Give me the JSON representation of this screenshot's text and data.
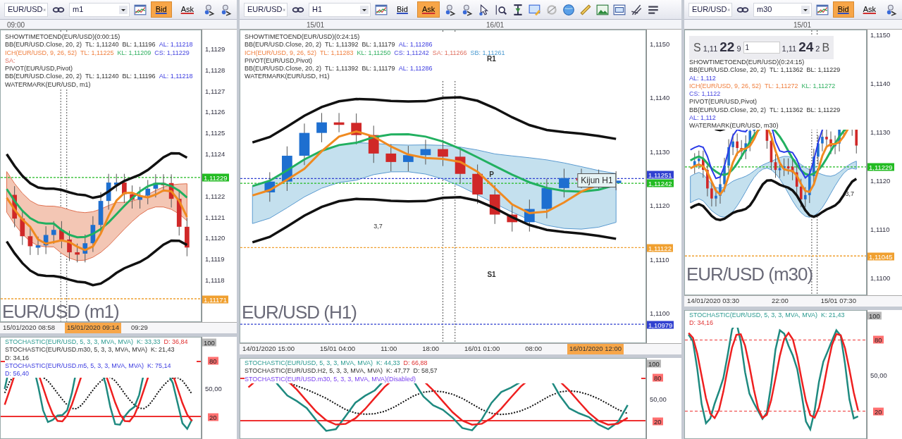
{
  "panels": [
    {
      "toolbar": {
        "symbol": "EUR/USD",
        "timeframe": "m1",
        "bid": {
          "label": "Bid",
          "selected": true
        },
        "ask": {
          "label": "Ask",
          "selected": false
        }
      },
      "top_times": [
        "09:00"
      ],
      "legend": [
        [
          {
            "text": "SHOWTIMETOEND(EUR/USD)(0:00:15)",
            "kind": "plain"
          }
        ],
        [
          {
            "text": "BB(EUR/USD.Close, 20, 2)",
            "kind": "plain"
          },
          {
            "text": "TL: 1,11240",
            "kind": "plain"
          },
          {
            "text": "BL: 1,11196",
            "kind": "plain"
          },
          {
            "text": "AL: 1,11218",
            "kind": "average"
          }
        ],
        [
          {
            "text": "ICH(EUR/USD, 9, 26, 52)",
            "kind": "ichimoku"
          },
          {
            "text": "TL: 1,11225",
            "kind": "ichimoku"
          },
          {
            "text": "KL: 1,11209",
            "kind": "kijun"
          },
          {
            "text": "CS: 1,11229",
            "kind": "chikou"
          },
          {
            "text": "SA:",
            "kind": "span_a"
          }
        ],
        [
          {
            "text": "PIVOT(EUR/USD,Pivot)",
            "kind": "plain"
          }
        ],
        [
          {
            "text": "BB(EUR/USD.Close, 20, 2)",
            "kind": "plain"
          },
          {
            "text": "TL: 1,11240",
            "kind": "plain"
          },
          {
            "text": "BL: 1,11196",
            "kind": "plain"
          },
          {
            "text": "AL: 1,11218",
            "kind": "average"
          }
        ],
        [
          {
            "text": "WATERMARK(EUR/USD, m1)",
            "kind": "plain"
          }
        ]
      ],
      "watermark": "EUR/USD (m1)",
      "price_ticks": [
        "1,1129",
        "1,1128",
        "1,1127",
        "1,1126",
        "1,1125",
        "1,1124",
        "1,1122",
        "1,1121",
        "1,1120",
        "1,1119",
        "1,1118"
      ],
      "price_tags": [
        {
          "text": "1,11229",
          "color": "#22bb22"
        },
        {
          "text": "1,11171",
          "color": "#f0a030"
        }
      ],
      "time_ticks": [
        {
          "text": "15/01/2020 08:58",
          "selected": false
        },
        {
          "text": "15/01/2020 09:14",
          "selected": true
        },
        {
          "text": "09:29",
          "selected": false
        }
      ],
      "stochastic": {
        "legend": [
          [
            {
              "text": "STOCHASTIC(EUR/USD, 5, 3, 3, MVA, MVA)",
              "kind": "stoch_k"
            },
            {
              "text": "K: 33,33",
              "kind": "stoch_k"
            },
            {
              "text": "D: 36,84",
              "kind": "stoch_d"
            }
          ],
          [
            {
              "text": "STOCHASTIC(EUR/USD.m30, 5, 3, 3, MVA, MVA)",
              "kind": "plain"
            },
            {
              "text": "K: 21,43",
              "kind": "plain"
            },
            {
              "text": "D: 34,16",
              "kind": "plain"
            }
          ],
          [
            {
              "text": "STOCHASTIC(EUR/USD.m5, 5, 3, 3, MVA, MVA)",
              "kind": "average"
            },
            {
              "text": "K: 75,14",
              "kind": "average"
            },
            {
              "text": "D: 56,40",
              "kind": "average"
            }
          ]
        ],
        "ticks": [
          {
            "text": "100",
            "kind": "top"
          },
          {
            "text": "80",
            "kind": "level"
          },
          {
            "text": "50,00",
            "kind": "plain"
          },
          {
            "text": "20",
            "kind": "level"
          }
        ]
      }
    },
    {
      "toolbar": {
        "symbol": "EUR/USD",
        "timeframe": "H1",
        "bid": {
          "label": "Bid",
          "selected": false
        },
        "ask": {
          "label": "Ask",
          "selected": true
        }
      },
      "top_times": [
        "15/01",
        "16/01"
      ],
      "legend": [
        [
          {
            "text": "SHOWTIMETOEND(EUR/USD)(0:24:15)",
            "kind": "plain"
          }
        ],
        [
          {
            "text": "BB(EUR/USD.Close, 20, 2)",
            "kind": "plain"
          },
          {
            "text": "TL: 1,11392",
            "kind": "plain"
          },
          {
            "text": "BL: 1,11179",
            "kind": "plain"
          },
          {
            "text": "AL: 1,11286",
            "kind": "average"
          }
        ],
        [
          {
            "text": "ICH(EUR/USD, 9, 26, 52)",
            "kind": "ichimoku"
          },
          {
            "text": "TL: 1,11283",
            "kind": "ichimoku"
          },
          {
            "text": "KL: 1,11250",
            "kind": "kijun"
          },
          {
            "text": "CS: 1,11242",
            "kind": "chikou"
          },
          {
            "text": "SA: 1,11266",
            "kind": "span_a"
          },
          {
            "text": "SB: 1,11261",
            "kind": "span_b"
          }
        ],
        [
          {
            "text": "PIVOT(EUR/USD,Pivot)",
            "kind": "plain"
          }
        ],
        [
          {
            "text": "BB(EUR/USD.Close, 20, 2)",
            "kind": "plain"
          },
          {
            "text": "TL: 1,11392",
            "kind": "plain"
          },
          {
            "text": "BL: 1,11179",
            "kind": "plain"
          },
          {
            "text": "AL: 1,11286",
            "kind": "average"
          }
        ],
        [
          {
            "text": "WATERMARK(EUR/USD, H1)",
            "kind": "plain"
          }
        ]
      ],
      "watermark": "EUR/USD (H1)",
      "labels": [
        {
          "text": "R1",
          "kind": "pivot"
        },
        {
          "text": "P",
          "kind": "pivot"
        },
        {
          "text": "S1",
          "kind": "pivot"
        },
        {
          "text": "Kijun H1",
          "kind": "box"
        },
        {
          "text": "3,7",
          "kind": "note"
        }
      ],
      "price_ticks": [
        "1,1150",
        "1,1140",
        "1,1130",
        "1,1120",
        "1,1110",
        "1,1100"
      ],
      "price_tags": [
        {
          "text": "1,11251",
          "color": "#3040d0"
        },
        {
          "text": "1,11242",
          "color": "#22bb22"
        },
        {
          "text": "1,11122",
          "color": "#f0a030"
        },
        {
          "text": "1,10979",
          "color": "#3040d0"
        }
      ],
      "time_ticks": [
        {
          "text": "14/01/2020 15:00",
          "selected": false
        },
        {
          "text": "15/01 04:00",
          "selected": false
        },
        {
          "text": "11:00",
          "selected": false
        },
        {
          "text": "18:00",
          "selected": false
        },
        {
          "text": "16/01 01:00",
          "selected": false
        },
        {
          "text": "08:00",
          "selected": false
        },
        {
          "text": "16/01/2020 12:00",
          "selected": true
        }
      ],
      "stochastic": {
        "legend": [
          [
            {
              "text": "STOCHASTIC(EUR/USD, 5, 3, 3, MVA, MVA)",
              "kind": "stoch_k"
            },
            {
              "text": "K: 44,33",
              "kind": "stoch_k"
            },
            {
              "text": "D: 66,88",
              "kind": "stoch_d"
            }
          ],
          [
            {
              "text": "STOCHASTIC(EUR/USD.H2, 5, 3, 3, MVA, MVA)",
              "kind": "plain"
            },
            {
              "text": "K: 47,77",
              "kind": "plain"
            },
            {
              "text": "D: 58,57",
              "kind": "plain"
            }
          ],
          [
            {
              "text": "STOCHASTIC(EUR/USD.m30, 5, 3, 3, MVA, MVA)(Disabled)",
              "kind": "disabled"
            }
          ]
        ],
        "ticks": [
          {
            "text": "100",
            "kind": "top"
          },
          {
            "text": "80",
            "kind": "level"
          },
          {
            "text": "50,00",
            "kind": "plain"
          },
          {
            "text": "20",
            "kind": "level"
          }
        ]
      }
    },
    {
      "toolbar": {
        "symbol": "EUR/USD",
        "timeframe": "m30",
        "bid": {
          "label": "Bid",
          "selected": true
        },
        "ask": {
          "label": "Ask",
          "selected": false
        }
      },
      "top_times": [
        "15/01"
      ],
      "quote": {
        "sell_label": "S",
        "sell_prefix": "1,11",
        "sell_big": "22",
        "sell_pip": "9",
        "amount": "1",
        "buy_prefix": "1,11",
        "buy_big": "24",
        "buy_pip": "2",
        "buy_label": "B"
      },
      "legend": [
        [
          {
            "text": "SHOWTIMETOEND(EUR/USD)(0:24:15)",
            "kind": "plain"
          }
        ],
        [
          {
            "text": "BB(EUR/USD.Close, 20, 2)",
            "kind": "plain"
          },
          {
            "text": "TL: 1,11362",
            "kind": "plain"
          },
          {
            "text": "BL: 1,11229",
            "kind": "plain"
          },
          {
            "text": "AL: 1,112",
            "kind": "average"
          }
        ],
        [
          {
            "text": "ICH(EUR/USD, 9, 26, 52)",
            "kind": "ichimoku"
          },
          {
            "text": "TL: 1,11272",
            "kind": "ichimoku"
          },
          {
            "text": "KL: 1,11272",
            "kind": "kijun"
          },
          {
            "text": "CS: 1,1122",
            "kind": "chikou"
          }
        ],
        [
          {
            "text": "PIVOT(EUR/USD,Pivot)",
            "kind": "plain"
          }
        ],
        [
          {
            "text": "BB(EUR/USD.Close, 20, 2)",
            "kind": "plain"
          },
          {
            "text": "TL: 1,11362",
            "kind": "plain"
          },
          {
            "text": "BL: 1,11229",
            "kind": "plain"
          },
          {
            "text": "AL: 1,112",
            "kind": "average"
          }
        ],
        [
          {
            "text": "WATERMARK(EUR/USD, m30)",
            "kind": "plain"
          }
        ]
      ],
      "watermark": "EUR/USD (m30)",
      "labels": [
        {
          "text": "3,7",
          "kind": "note"
        }
      ],
      "price_ticks": [
        "1,1150",
        "1,1140",
        "1,1130",
        "1,1120",
        "1,1110",
        "1,1100"
      ],
      "price_tags": [
        {
          "text": "1,11229",
          "color": "#22bb22"
        },
        {
          "text": "1,11045",
          "color": "#f0a030"
        }
      ],
      "time_ticks": [
        {
          "text": "14/01/2020 03:30",
          "selected": false
        },
        {
          "text": "22:00",
          "selected": false
        },
        {
          "text": "15/01 07:30",
          "selected": false
        }
      ],
      "stochastic": {
        "legend": [
          [
            {
              "text": "STOCHASTIC(EUR/USD, 5, 3, 3, MVA, MVA)",
              "kind": "stoch_k"
            },
            {
              "text": "K: 21,43",
              "kind": "stoch_k"
            },
            {
              "text": "D: 34,16",
              "kind": "stoch_d"
            }
          ]
        ],
        "ticks": [
          {
            "text": "100",
            "kind": "top"
          },
          {
            "text": "80",
            "kind": "level"
          },
          {
            "text": "50,00",
            "kind": "plain"
          },
          {
            "text": "20",
            "kind": "level"
          }
        ]
      }
    }
  ]
}
